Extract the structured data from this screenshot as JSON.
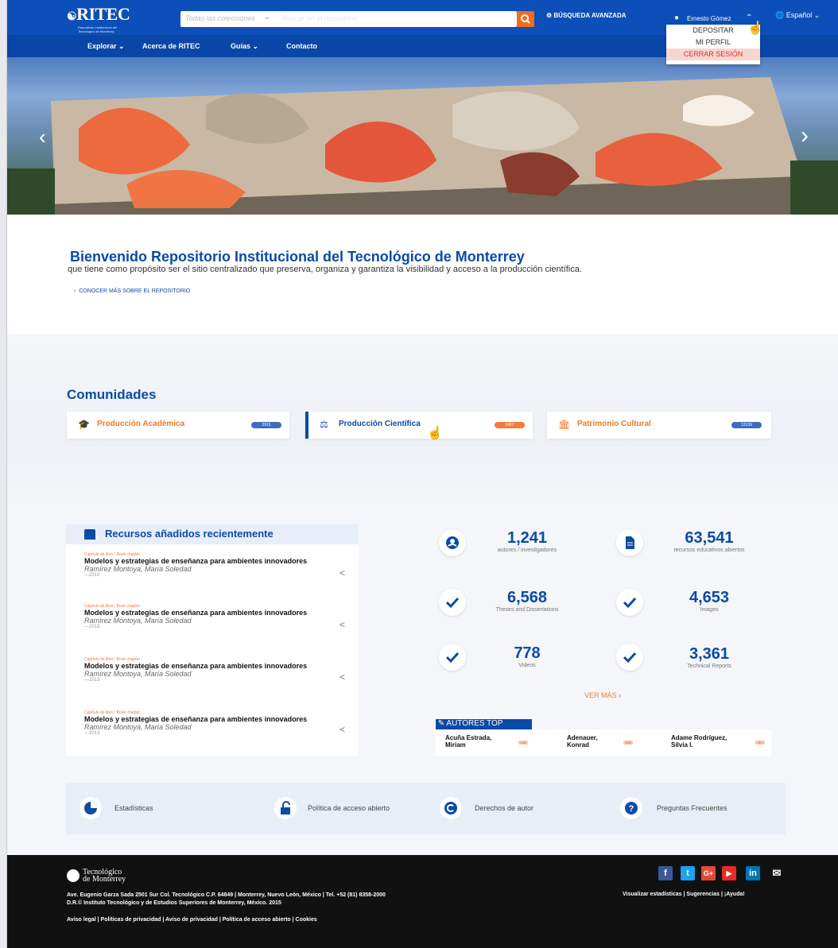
{
  "header": {
    "logo_text": "RITEC",
    "logo_subtitle": "Repositorio Institucional del Tecnológico de Monterrey",
    "search_scope": "Todas las colecciones",
    "search_placeholder": "Buscar en el repositorio",
    "advanced_search": "BÚSQUEDA AVANZADA",
    "user_name": "Ernesto Gómez",
    "language": "Español"
  },
  "user_menu": {
    "items": [
      "DEPOSITAR",
      "MI PERFIL",
      "CERRAR SESIÓN"
    ]
  },
  "nav": {
    "items": [
      "Explorar",
      "Acerca de RITEC",
      "Guías",
      "Contacto"
    ]
  },
  "welcome": {
    "title": "Bienvenido Repositorio Institucional del Tecnológico de Monterrey",
    "subtitle": "que tiene como propósito ser el sitio centralizado que preserva, organiza y garantiza la visibilidad y acceso a la producción científica.",
    "more_link": "CONOCER MÁS SOBRE EL REPOSITORIO"
  },
  "communities": {
    "title": "Comunidades",
    "items": [
      {
        "label": "Producción Académica",
        "count": "2915",
        "color": "#f07a25",
        "icon": "graduation-cap-icon"
      },
      {
        "label": "Producción Científica",
        "count": "3407",
        "color": "#0b4aa6",
        "icon": "flask-icon"
      },
      {
        "label": "Patrimonio Cultural",
        "count": "12139",
        "color": "#f07a25",
        "icon": "museum-icon"
      }
    ]
  },
  "recent": {
    "title": "Recursos añadidos recientemente",
    "items": [
      {
        "tag": "Capítulo de libro / Book chapter",
        "title": "Modelos y estrategias de enseñanza para ambientes innovadores",
        "author": "Ramírez Montoya, María Soledad",
        "date": "—2013"
      },
      {
        "tag": "Capítulo de libro / Book chapter",
        "title": "Modelos y estrategias de enseñanza para ambientes innovadores",
        "author": "Ramírez Montoya, María Soledad",
        "date": "—2013"
      },
      {
        "tag": "Capítulo de libro / Book chapter",
        "title": "Modelos y estrategias de enseñanza para ambientes innovadores",
        "author": "Ramírez Montoya, María Soledad",
        "date": "—2013"
      },
      {
        "tag": "Capítulo de libro / Book chapter",
        "title": "Modelos y estrategias de enseñanza para ambientes innovadores",
        "author": "Ramírez Montoya, María Soledad",
        "date": "—2013"
      }
    ]
  },
  "stats": [
    {
      "value": "1,241",
      "label": "autores / investigadores",
      "icon": "user-icon"
    },
    {
      "value": "63,541",
      "label": "recursos educativos abiertos",
      "icon": "document-icon"
    },
    {
      "value": "6,568",
      "label": "Theses and Dissertations",
      "icon": "check-icon"
    },
    {
      "value": "4,653",
      "label": "Images",
      "icon": "check-icon"
    },
    {
      "value": "778",
      "label": "Videos",
      "icon": "check-icon"
    },
    {
      "value": "3,361",
      "label": "Technical Reports",
      "icon": "check-icon"
    }
  ],
  "see_more": "VER MÁS",
  "top_authors": {
    "title": "AUTORES TOP",
    "items": [
      {
        "name1": "Acuña Estrada,",
        "name2": "Miriam",
        "count": "133"
      },
      {
        "name1": "Adenauer,",
        "name2": "Konrad",
        "count": "100"
      },
      {
        "name1": "Adame Rodríguez,",
        "name2": "Silvia I.",
        "count": "51"
      }
    ]
  },
  "quick_links": [
    {
      "label": "Estadísticas",
      "icon": "pie-chart-icon"
    },
    {
      "label": "Política de acceso abierto",
      "icon": "unlock-icon"
    },
    {
      "label": "Derechos de autor",
      "icon": "copyright-icon"
    },
    {
      "label": "Preguntas Frecuentes",
      "icon": "question-icon"
    }
  ],
  "footer": {
    "logo_line1": "Tecnológico",
    "logo_line2": "de Monterrey",
    "address": "Ave. Eugenio Garza Sada 2501 Sur Col. Tecnológico C.P. 64849 | Monterrey, Nuevo León, México | Tel. +52 (81) 8358-2000",
    "copyright": "D.R.© Instituto Tecnológico y de Estudios Superiores de Monterrey, México. 2015",
    "legal": "Aviso legal | Políticas de privacidad | Aviso de privacidad | Política de acceso abierto | Cookies",
    "right_links": "Visualizar estadísticas | Sugerencias | ¡Ayuda!",
    "social": [
      "f",
      "t",
      "G+",
      "▶",
      "in",
      "✉"
    ]
  },
  "colors": {
    "primary": "#0b4aa6",
    "accent": "#f46b1a",
    "topbar": "#0d4fb8"
  }
}
